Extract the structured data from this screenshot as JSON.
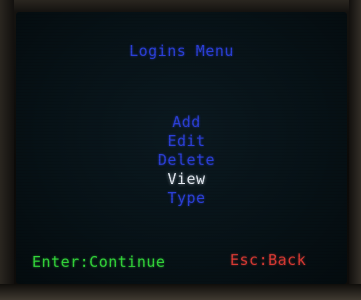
{
  "screen": {
    "title": "Logins Menu",
    "menu": {
      "items": [
        "Add",
        "Edit",
        "Delete",
        "View",
        "Type"
      ],
      "selected_index": 3
    },
    "footer": {
      "enter_hint": "Enter:Continue",
      "esc_hint": "Esc:Back"
    }
  },
  "colors": {
    "menu_text": "#2b3fd6",
    "selected_text": "#e6ecf4",
    "enter_hint": "#32d43a",
    "esc_hint": "#d83a34",
    "screen_background": "#071217"
  }
}
